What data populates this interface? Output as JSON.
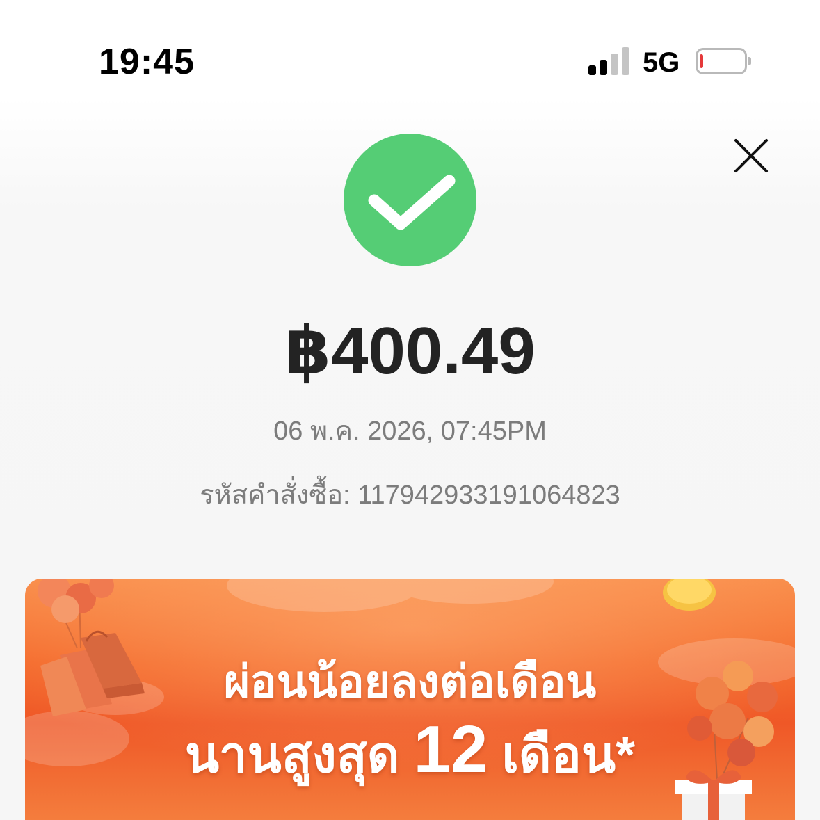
{
  "status_bar": {
    "time": "19:45",
    "network": "5G",
    "signal_bars_active": 2,
    "signal_bars_total": 4,
    "battery_level_fraction": 0.05,
    "battery_color": "#e5393a",
    "icons": [
      "signal-icon",
      "battery-icon"
    ]
  },
  "close": {
    "icon": "close-icon"
  },
  "success": {
    "icon": "checkmark-icon",
    "color": "#55cd75"
  },
  "payment": {
    "amount": "฿400.49",
    "datetime": "06 พ.ค. 2026, 07:45PM",
    "order_label": "รหัสคำสั่งซื้อ:",
    "order_number": "117942933191064823"
  },
  "banner": {
    "line1": "ผ่อนน้อยลงต่อเดือน",
    "line2_prefix": "นานสูงสุด",
    "line2_number": "12",
    "line2_suffix": "เดือน*",
    "colors": {
      "top": "#f98d4a",
      "middle": "#ef5827"
    },
    "icons": [
      "shopping-bags-icon",
      "balloons-icon",
      "gift-box-icon",
      "coin-icon"
    ]
  }
}
